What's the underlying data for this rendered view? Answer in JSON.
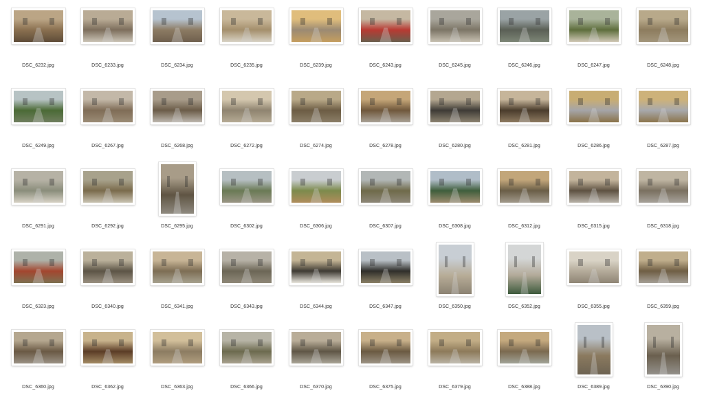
{
  "photos": [
    {
      "name": "DSC_6232.jpg",
      "orientation": "landscape",
      "palette": [
        "#bba585",
        "#8a7050",
        "#5e4c38"
      ]
    },
    {
      "name": "DSC_6233.jpg",
      "orientation": "landscape",
      "palette": [
        "#b9ab95",
        "#7d6e5c",
        "#cac3b5"
      ]
    },
    {
      "name": "DSC_6234.jpg",
      "orientation": "landscape",
      "palette": [
        "#b6c3cf",
        "#8c7b63",
        "#6f604e"
      ]
    },
    {
      "name": "DSC_6235.jpg",
      "orientation": "landscape",
      "palette": [
        "#c9b89a",
        "#a48f6c",
        "#d8d2c4"
      ]
    },
    {
      "name": "DSC_6239.jpg",
      "orientation": "landscape",
      "palette": [
        "#e0bd7c",
        "#9b8a73",
        "#c59e5f"
      ]
    },
    {
      "name": "DSC_6243.jpg",
      "orientation": "landscape",
      "palette": [
        "#c5b8a2",
        "#b83a32",
        "#6a5e4c"
      ]
    },
    {
      "name": "DSC_6245.jpg",
      "orientation": "landscape",
      "palette": [
        "#a9a69c",
        "#7c7566",
        "#c7c0b1"
      ]
    },
    {
      "name": "DSC_6246.jpg",
      "orientation": "landscape",
      "palette": [
        "#9aa3a5",
        "#5a5f55",
        "#7d8677"
      ]
    },
    {
      "name": "DSC_6247.jpg",
      "orientation": "landscape",
      "palette": [
        "#a9b39a",
        "#5e6e3c",
        "#d0c8b6"
      ]
    },
    {
      "name": "DSC_6248.jpg",
      "orientation": "landscape",
      "palette": [
        "#b8a98a",
        "#8d7c5e",
        "#a2957b"
      ]
    },
    {
      "name": "DSC_6249.jpg",
      "orientation": "landscape",
      "palette": [
        "#b7c3c4",
        "#4b6a36",
        "#6f7e5e"
      ]
    },
    {
      "name": "DSC_6267.jpg",
      "orientation": "landscape",
      "palette": [
        "#c3b8a8",
        "#7f6c56",
        "#9b8c76"
      ]
    },
    {
      "name": "DSC_6268.jpg",
      "orientation": "landscape",
      "palette": [
        "#a89c8a",
        "#6b5c48",
        "#bdb7ae"
      ]
    },
    {
      "name": "DSC_6272.jpg",
      "orientation": "landscape",
      "palette": [
        "#d4c7ae",
        "#8f8470",
        "#b5aa94"
      ]
    },
    {
      "name": "DSC_6274.jpg",
      "orientation": "landscape",
      "palette": [
        "#b9a988",
        "#6c5c44",
        "#8b7e67"
      ]
    },
    {
      "name": "DSC_6278.jpg",
      "orientation": "landscape",
      "palette": [
        "#c5a678",
        "#70583c",
        "#a8a095"
      ]
    },
    {
      "name": "DSC_6280.jpg",
      "orientation": "landscape",
      "palette": [
        "#b4a790",
        "#3e3b36",
        "#8c8270"
      ]
    },
    {
      "name": "DSC_6281.jpg",
      "orientation": "landscape",
      "palette": [
        "#c6b59a",
        "#4a3c2c",
        "#8d7a60"
      ]
    },
    {
      "name": "DSC_6286.jpg",
      "orientation": "landscape",
      "palette": [
        "#c8ad73",
        "#a5a5a8",
        "#8a7248"
      ]
    },
    {
      "name": "DSC_6287.jpg",
      "orientation": "landscape",
      "palette": [
        "#cdb27a",
        "#a8a9ac",
        "#8b744c"
      ]
    },
    {
      "name": "DSC_6291.jpg",
      "orientation": "landscape",
      "palette": [
        "#b6b2a5",
        "#8a8d7b",
        "#d7d2c5"
      ]
    },
    {
      "name": "DSC_6292.jpg",
      "orientation": "landscape",
      "palette": [
        "#a8a28c",
        "#7a6b4c",
        "#c9c3b2"
      ]
    },
    {
      "name": "DSC_6295.jpg",
      "orientation": "portrait",
      "palette": [
        "#a89c88",
        "#5f5443",
        "#8f8a80"
      ]
    },
    {
      "name": "DSC_6302.jpg",
      "orientation": "landscape",
      "palette": [
        "#b6bfc2",
        "#6a7a55",
        "#9a9585"
      ]
    },
    {
      "name": "DSC_6306.jpg",
      "orientation": "landscape",
      "palette": [
        "#c9cdd0",
        "#7c8a4c",
        "#b08d5c"
      ]
    },
    {
      "name": "DSC_6307.jpg",
      "orientation": "landscape",
      "palette": [
        "#b2b7b6",
        "#6f6a4a",
        "#8d8778"
      ]
    },
    {
      "name": "DSC_6308.jpg",
      "orientation": "landscape",
      "palette": [
        "#b0bdc8",
        "#3f5e3c",
        "#9b8b6e"
      ]
    },
    {
      "name": "DSC_6312.jpg",
      "orientation": "landscape",
      "palette": [
        "#c2a67a",
        "#6a5e47",
        "#a29a8c"
      ]
    },
    {
      "name": "DSC_6315.jpg",
      "orientation": "landscape",
      "palette": [
        "#c3b49c",
        "#5e5242",
        "#b8b2a8"
      ]
    },
    {
      "name": "DSC_6318.jpg",
      "orientation": "landscape",
      "palette": [
        "#bfb5a2",
        "#7a7060",
        "#a7a29a"
      ]
    },
    {
      "name": "DSC_6323.jpg",
      "orientation": "landscape",
      "palette": [
        "#aeb2a9",
        "#a3462f",
        "#7d7050"
      ]
    },
    {
      "name": "DSC_6340.jpg",
      "orientation": "landscape",
      "palette": [
        "#bbb19b",
        "#5c5446",
        "#9a9080"
      ]
    },
    {
      "name": "DSC_6341.jpg",
      "orientation": "landscape",
      "palette": [
        "#c8b596",
        "#7d6d54",
        "#a7a28f"
      ]
    },
    {
      "name": "DSC_6343.jpg",
      "orientation": "landscape",
      "palette": [
        "#b7b2a7",
        "#6c6656",
        "#8f8878"
      ]
    },
    {
      "name": "DSC_6344.jpg",
      "orientation": "landscape",
      "palette": [
        "#c4b595",
        "#3e3a33",
        "#e9e6dd"
      ]
    },
    {
      "name": "DSC_6347.jpg",
      "orientation": "landscape",
      "palette": [
        "#b9c0c6",
        "#2f2e2a",
        "#8a8066"
      ]
    },
    {
      "name": "DSC_6350.jpg",
      "orientation": "portrait",
      "palette": [
        "#c8ced4",
        "#b8ad98",
        "#8b8272"
      ]
    },
    {
      "name": "DSC_6352.jpg",
      "orientation": "portrait",
      "palette": [
        "#d4d6d6",
        "#b3aa99",
        "#3d5a3c"
      ]
    },
    {
      "name": "DSC_6355.jpg",
      "orientation": "landscape",
      "palette": [
        "#d9d3c6",
        "#b4ab9a",
        "#8f8575"
      ]
    },
    {
      "name": "DSC_6359.jpg",
      "orientation": "landscape",
      "palette": [
        "#c0ae8c",
        "#6f5e44",
        "#a59f95"
      ]
    },
    {
      "name": "DSC_6360.jpg",
      "orientation": "landscape",
      "palette": [
        "#b5a78f",
        "#6a5944",
        "#9a9184"
      ]
    },
    {
      "name": "DSC_6362.jpg",
      "orientation": "landscape",
      "palette": [
        "#c8b38c",
        "#5b3c26",
        "#a38b64"
      ]
    },
    {
      "name": "DSC_6363.jpg",
      "orientation": "landscape",
      "palette": [
        "#d2bf9a",
        "#8c7c62",
        "#b09d7e"
      ]
    },
    {
      "name": "DSC_6366.jpg",
      "orientation": "landscape",
      "palette": [
        "#b7b4a6",
        "#6c6a4e",
        "#a8a18e"
      ]
    },
    {
      "name": "DSC_6370.jpg",
      "orientation": "landscape",
      "palette": [
        "#b9ad98",
        "#5f5646",
        "#a9a496"
      ]
    },
    {
      "name": "DSC_6375.jpg",
      "orientation": "landscape",
      "palette": [
        "#c8b08a",
        "#6b5a42",
        "#9c9384"
      ]
    },
    {
      "name": "DSC_6379.jpg",
      "orientation": "landscape",
      "palette": [
        "#c2ad86",
        "#8d7a5a",
        "#b9b2a2"
      ]
    },
    {
      "name": "DSC_6388.jpg",
      "orientation": "landscape",
      "palette": [
        "#c4a97e",
        "#7b6a50",
        "#a1a397"
      ]
    },
    {
      "name": "DSC_6389.jpg",
      "orientation": "portrait",
      "palette": [
        "#b9c0c7",
        "#8b7a5f",
        "#6d6352"
      ]
    },
    {
      "name": "DSC_6390.jpg",
      "orientation": "portrait",
      "palette": [
        "#b8b0a0",
        "#6a5f4e",
        "#93908a"
      ]
    }
  ]
}
